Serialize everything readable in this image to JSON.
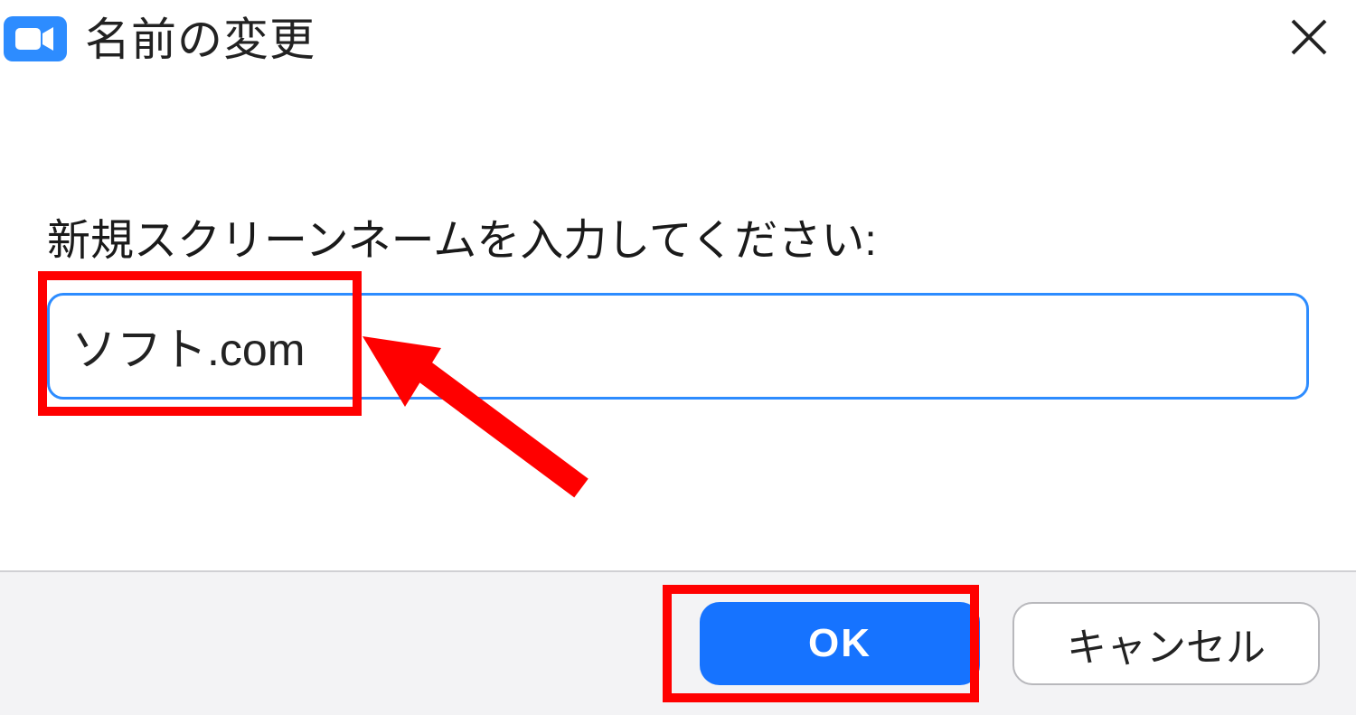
{
  "dialog": {
    "title": "名前の変更",
    "prompt": "新規スクリーンネームを入力してください:",
    "input_value": "ソフト.com",
    "buttons": {
      "ok": "OK",
      "cancel": "キャンセル"
    }
  },
  "colors": {
    "accent": "#2D8CFF",
    "annotation": "#FF0000"
  }
}
